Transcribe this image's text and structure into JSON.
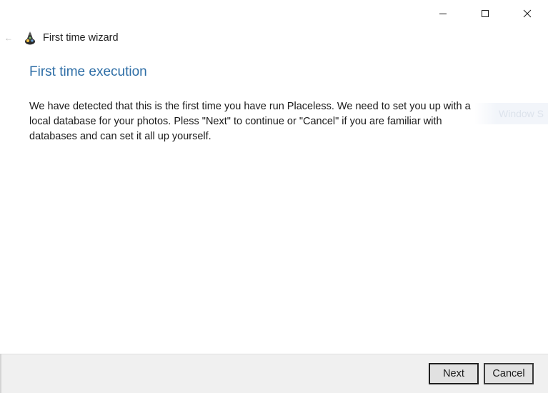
{
  "window": {
    "title": "First time wizard",
    "controls": {
      "minimize_icon": "minimize-icon",
      "maximize_icon": "maximize-icon",
      "close_icon": "close-icon"
    }
  },
  "nav": {
    "back_glyph": "←"
  },
  "page": {
    "heading": "First time execution",
    "body": "We have detected that this is the first time you have run Placeless. We need to set you up with a local database for your photos. Pless \"Next\" to continue or \"Cancel\" if you are familiar with databases and can set it all up yourself."
  },
  "overlay": {
    "watermark": "Window S"
  },
  "footer": {
    "next_label": "Next",
    "cancel_label": "Cancel"
  },
  "colors": {
    "heading": "#2e6ea6",
    "footer_bg": "#f0f0f0",
    "button_bg": "#e1e1e1"
  }
}
